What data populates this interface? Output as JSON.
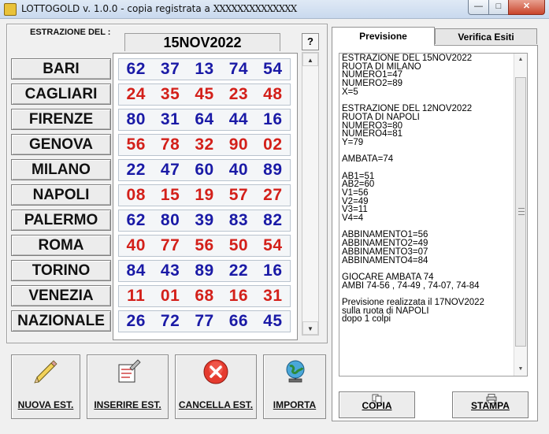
{
  "window": {
    "title_prefix": "LOTTOGOLD v. 1.0.0 - copia registrata a ",
    "registered_to": "XXXXXXXXXXXXXX",
    "minimize": "—",
    "maximize": "□",
    "close": "✕"
  },
  "extraction": {
    "label": "ESTRAZIONE DEL :",
    "date": "15NOV2022",
    "help": "?"
  },
  "wheels": [
    {
      "name": "BARI",
      "numbers": [
        "62",
        "37",
        "13",
        "74",
        "54"
      ],
      "color": "#1a1aa6"
    },
    {
      "name": "CAGLIARI",
      "numbers": [
        "24",
        "35",
        "45",
        "23",
        "48"
      ],
      "color": "#d3201a"
    },
    {
      "name": "FIRENZE",
      "numbers": [
        "80",
        "31",
        "64",
        "44",
        "16"
      ],
      "color": "#1a1aa6"
    },
    {
      "name": "GENOVA",
      "numbers": [
        "56",
        "78",
        "32",
        "90",
        "02"
      ],
      "color": "#d3201a"
    },
    {
      "name": "MILANO",
      "numbers": [
        "22",
        "47",
        "60",
        "40",
        "89"
      ],
      "color": "#1a1aa6"
    },
    {
      "name": "NAPOLI",
      "numbers": [
        "08",
        "15",
        "19",
        "57",
        "27"
      ],
      "color": "#d3201a"
    },
    {
      "name": "PALERMO",
      "numbers": [
        "62",
        "80",
        "39",
        "83",
        "82"
      ],
      "color": "#1a1aa6"
    },
    {
      "name": "ROMA",
      "numbers": [
        "40",
        "77",
        "56",
        "50",
        "54"
      ],
      "color": "#d3201a"
    },
    {
      "name": "TORINO",
      "numbers": [
        "84",
        "43",
        "89",
        "22",
        "16"
      ],
      "color": "#1a1aa6"
    },
    {
      "name": "VENEZIA",
      "numbers": [
        "11",
        "01",
        "68",
        "16",
        "31"
      ],
      "color": "#d3201a"
    },
    {
      "name": "NAZIONALE",
      "numbers": [
        "26",
        "72",
        "77",
        "66",
        "45"
      ],
      "color": "#1a1aa6"
    }
  ],
  "toolbar": {
    "new_label": "NUOVA EST.",
    "insert_label": "INSERIRE EST.",
    "delete_label": "CANCELLA EST.",
    "import_label": "IMPORTA"
  },
  "tabs": {
    "forecast": "Previsione",
    "verify": "Verifica Esiti"
  },
  "forecast_lines": [
    "ESTRAZIONE DEL 15NOV2022",
    "RUOTA DI MILANO",
    "NUMERO1=47",
    "NUMERO2=89",
    "X=5",
    "",
    "ESTRAZIONE DEL 12NOV2022",
    "RUOTA DI NAPOLI",
    "NUMERO3=80",
    "NUMERO4=81",
    "Y=79",
    "",
    "AMBATA=74",
    "",
    "AB1=51",
    "AB2=60",
    "V1=56",
    "V2=49",
    "V3=11",
    "V4=4",
    "",
    "ABBINAMENTO1=56",
    "ABBINAMENTO2=49",
    "ABBINAMENTO3=07",
    "ABBINAMENTO4=84",
    "",
    "GIOCARE AMBATA 74",
    "AMBI 74-56 , 74-49 , 74-07, 74-84",
    "",
    "Previsione realizzata il 17NOV2022",
    "sulla ruota di NAPOLI",
    "dopo 1 colpi"
  ],
  "panel_buttons": {
    "copy_label": "COPIA",
    "print_label": "STAMPA"
  },
  "colors": {
    "blue_numbers": "#1a1aa6",
    "red_numbers": "#d3201a",
    "close_button": "#c9452c"
  }
}
